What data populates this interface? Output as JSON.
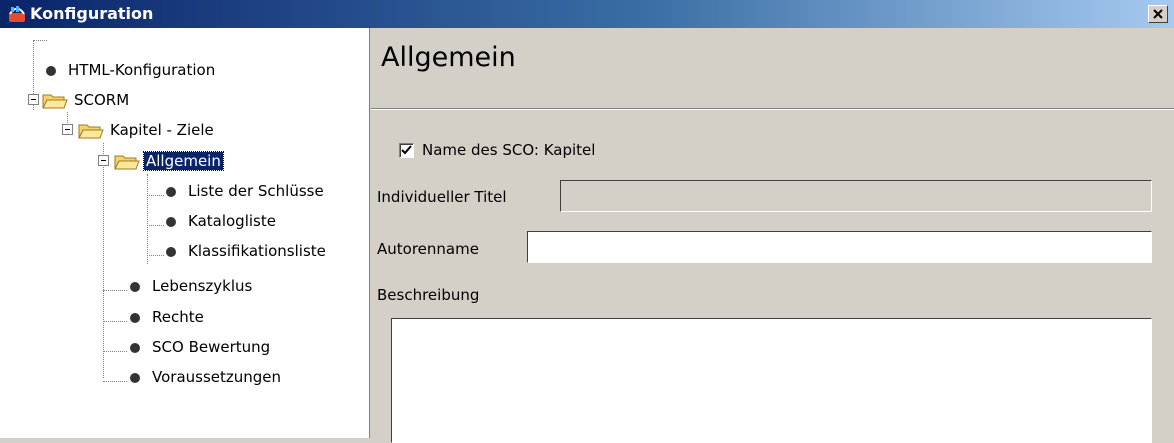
{
  "window": {
    "title": "Konfiguration",
    "close_symbol": "✕",
    "app_icon": "app-logo-icon",
    "close_icon": "close-icon"
  },
  "tree": {
    "html_config": "HTML-Konfiguration",
    "scorm": "SCORM",
    "kapitel": "Kapitel - Ziele",
    "allgemein": "Allgemein",
    "liste": "Liste der Schlüsse",
    "katalogliste": "Katalogliste",
    "klassifikationsliste": "Klassifikationsliste",
    "lebenszyklus": "Lebenszyklus",
    "rechte": "Rechte",
    "sco_bewertung": "SCO Bewertung",
    "voraussetzungen": "Voraussetzungen"
  },
  "panel": {
    "title": "Allgemein",
    "checkbox_label": "Name des SCO: Kapitel",
    "checkbox_checked": true,
    "titel_label": "Individueller Titel",
    "titel_value": "",
    "autor_label": "Autorenname",
    "autor_value": "",
    "beschreibung_label": "Beschreibung",
    "beschreibung_value": ""
  },
  "colors": {
    "titlebar_start": "#0a246a",
    "titlebar_end": "#a6caf0",
    "selection": "#0a246a",
    "folder": "#f5d36a",
    "dialog_bg": "#d4d0c8"
  }
}
